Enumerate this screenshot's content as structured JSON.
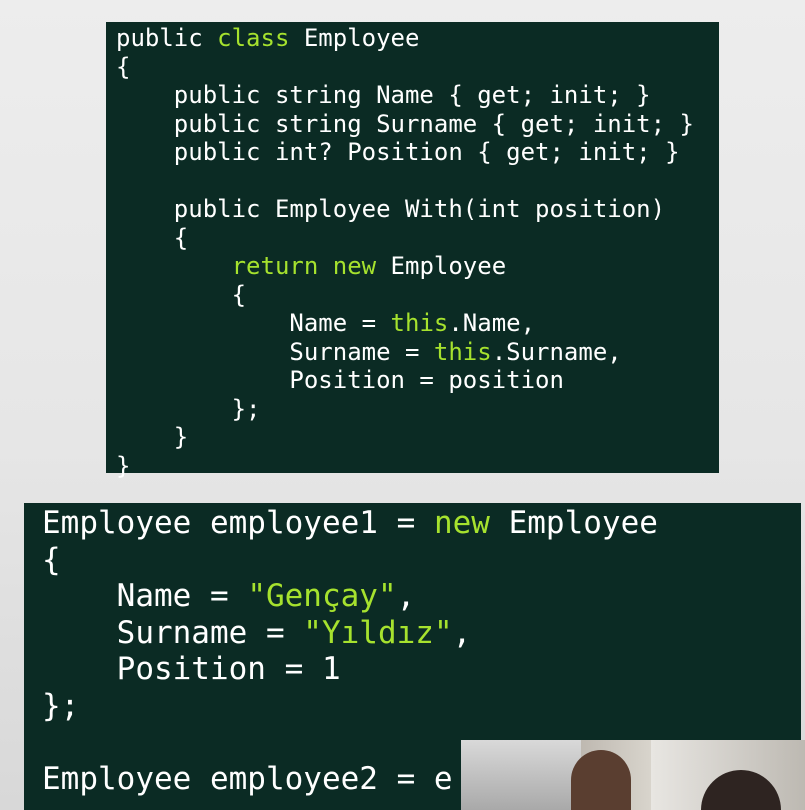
{
  "top_code": {
    "l1a": "public ",
    "l1b": "class",
    "l1c": " Employee",
    "l2": "{",
    "l3": "    public string Name { get; init; }",
    "l4": "    public string Surname { get; init; }",
    "l5": "    public int? Position { get; init; }",
    "l6": "",
    "l7": "    public Employee With(int position)",
    "l8": "    {",
    "l9a": "        ",
    "l9b": "return new",
    "l9c": " Employee",
    "l10": "        {",
    "l11a": "            Name = ",
    "l11b": "this",
    "l11c": ".Name,",
    "l12a": "            Surname = ",
    "l12b": "this",
    "l12c": ".Surname,",
    "l13": "            Position = position",
    "l14": "        };",
    "l15": "    }",
    "l16": "}"
  },
  "bottom_code": {
    "l1a": "Employee employee1 = ",
    "l1b": "new",
    "l1c": " Employee",
    "l2": "{",
    "l3a": "    Name = ",
    "l3b": "\"Gençay\"",
    "l3c": ",",
    "l4a": "    Surname = ",
    "l4b": "\"Yıldız\"",
    "l4c": ",",
    "l5": "    Position = 1",
    "l6": "};",
    "l7": "",
    "l8": "Employee employee2 = e"
  },
  "colors": {
    "code_background": "#0b2b24",
    "keyword": "#a6e22e",
    "text": "#ffffff"
  }
}
